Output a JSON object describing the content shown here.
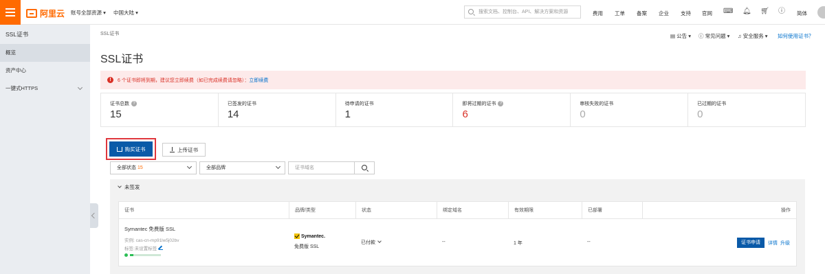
{
  "topbar": {
    "logo_text": "阿里云",
    "account_dropdown": "账号全部资源",
    "region_dropdown": "中国大陆",
    "search_placeholder": "搜索文档、控制台、API、解决方案和资源",
    "nav": [
      "费用",
      "工单",
      "备案",
      "企业",
      "支持",
      "官网"
    ],
    "lang": "简体",
    "icons": [
      "terminal-icon",
      "bell-icon",
      "cart-icon",
      "help-icon"
    ]
  },
  "sidebar": {
    "title": "SSL证书",
    "items": [
      {
        "label": "概览",
        "active": true
      },
      {
        "label": "资产中心",
        "active": false
      },
      {
        "label": "一键式HTTPS",
        "active": false
      }
    ]
  },
  "main": {
    "breadcrumb": "SSL证书",
    "title": "SSL证书",
    "help_links": {
      "announcement": "公告",
      "faq": "常见问题",
      "security": "安全服务",
      "how_to": "如何使用证书？"
    },
    "alert": {
      "text": "6 个证书即将到期，建议您立即续费（如已完成续费请忽略）",
      "link": "立即续费"
    },
    "stats": [
      {
        "label": "证书总数",
        "value": "15",
        "help": true,
        "tone": "normal"
      },
      {
        "label": "已签发的证书",
        "value": "14",
        "help": false,
        "tone": "normal"
      },
      {
        "label": "待申请的证书",
        "value": "1",
        "help": false,
        "tone": "normal"
      },
      {
        "label": "即将过期的证书",
        "value": "6",
        "help": true,
        "tone": "red"
      },
      {
        "label": "审核失败的证书",
        "value": "0",
        "help": false,
        "tone": "grey"
      },
      {
        "label": "已过期的证书",
        "value": "0",
        "help": false,
        "tone": "grey"
      }
    ],
    "buy_button": "购买证书",
    "upload_button": "上传证书",
    "filters": {
      "status_label": "全部状态",
      "status_count": "15",
      "brand_label": "全部品牌",
      "domain_placeholder": "证书域名"
    },
    "group": {
      "title": "未签发",
      "columns": [
        "证书",
        "品牌/类型",
        "状态",
        "绑定域名",
        "有效期限",
        "已部署",
        "操作"
      ],
      "rows": [
        {
          "name": "Symantec 免费版 SSL",
          "instance": "实例: cas-cn-mp91lw5j02bv",
          "tag": "标签:未设置标签",
          "progress": 0.1,
          "brand": "Symantec.",
          "type": "免费版 SSL",
          "status": "已付款",
          "domain": "--",
          "validity": "1 年",
          "deployed": "--",
          "apply": "证书申请",
          "detail": "详情",
          "upgrade": "升级"
        }
      ]
    }
  },
  "colors": {
    "brand_orange": "#ff6a00",
    "primary_blue": "#0a5aa8",
    "link_blue": "#0070cc",
    "alert_red": "#d93026"
  }
}
